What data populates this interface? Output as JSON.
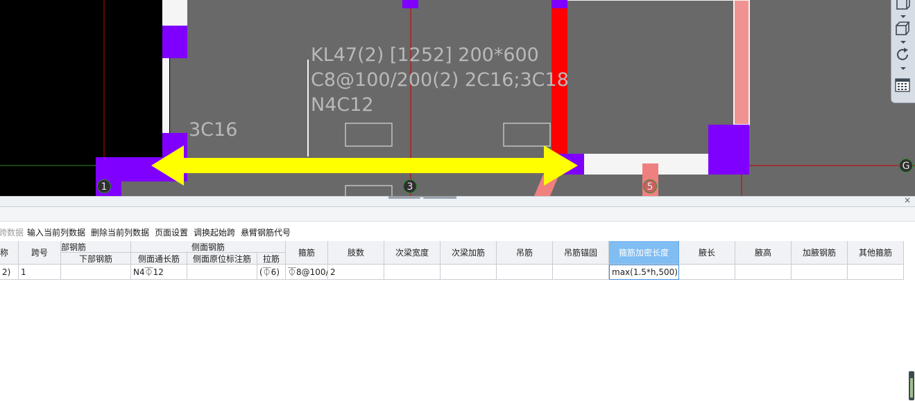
{
  "cad": {
    "beam_label_line1": "KL47(2) [1252] 200*600",
    "beam_label_line2": "C8@100/200(2) 2C16;3C18",
    "beam_label_line3": "N4C12",
    "rebar_label": "3C16",
    "axis_markers": [
      "1",
      "3",
      "5",
      "G"
    ],
    "colors": {
      "background": "#696969",
      "column": "#8000ff",
      "beam_highlight": "#ffff00",
      "red_member": "#ff0000",
      "pink_member": "#f08080",
      "grid_line": "#cc0000",
      "left_region": "#000000"
    }
  },
  "toolbar": {
    "icons": [
      "cube-top-icon",
      "cube-view-icon",
      "rotate-icon",
      "grid-view-icon"
    ]
  },
  "panel": {
    "close_label": "×"
  },
  "menu": {
    "items": [
      "跨数据",
      "输入当前列数据",
      "删除当前列数据",
      "页面设置",
      "调换起始跨",
      "悬臂钢筋代号"
    ]
  },
  "grid": {
    "group_headers": {
      "bottom_rebar": "部钢筋",
      "side_rebar": "侧面钢筋"
    },
    "headers": {
      "name": "称",
      "span_no": "跨号",
      "bottom_rebar_sub": "下部钢筋",
      "side_through": "侧面通长筋",
      "side_in_situ": "侧面原位标注筋",
      "tie_bar": "拉筋",
      "stirrup": "箍筋",
      "legs": "肢数",
      "sec_beam_width": "次梁宽度",
      "sec_beam_add": "次梁加筋",
      "hanger": "吊筋",
      "hanger_anchor": "吊筋锚固",
      "stirrup_dense_len": "箍筋加密长度",
      "haunch_len": "腋长",
      "haunch_height": "腋高",
      "haunch_rebar": "加腋钢筋",
      "other_stirrup": "其他箍筋"
    },
    "row": {
      "name": "2)",
      "span_no": "1",
      "bottom_rebar": "",
      "side_through": "N4⏁12",
      "side_in_situ": "",
      "tie_bar": "(⏁6)",
      "stirrup": "⏁8@100/",
      "legs": "2",
      "sec_beam_width": "",
      "sec_beam_add": "",
      "hanger": "",
      "hanger_anchor": "",
      "stirrup_dense_len": "max(1.5*h,500)",
      "haunch_len": "",
      "haunch_height": "",
      "haunch_rebar": "",
      "other_stirrup": ""
    }
  }
}
